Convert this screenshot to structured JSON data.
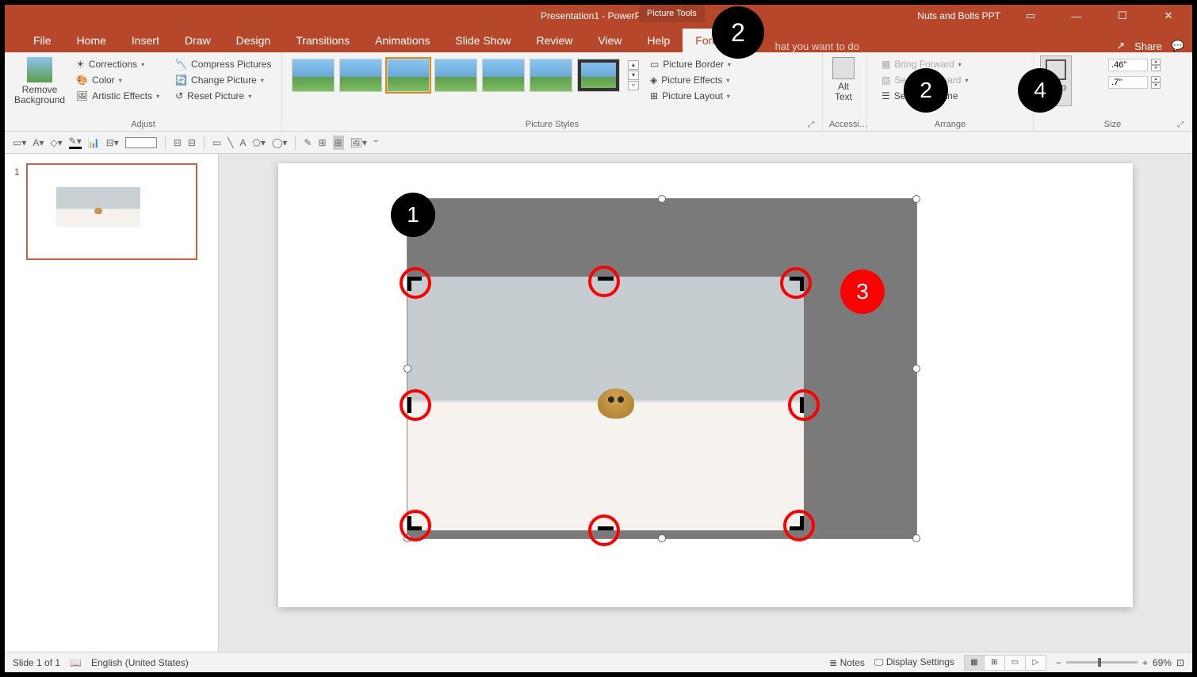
{
  "titlebar": {
    "title": "Presentation1 - PowerPoint",
    "tools_tab": "Picture Tools",
    "brand": "Nuts and Bolts PPT"
  },
  "tabs": {
    "items": [
      "File",
      "Home",
      "Insert",
      "Draw",
      "Design",
      "Transitions",
      "Animations",
      "Slide Show",
      "Review",
      "View",
      "Help",
      "Format"
    ],
    "active": "Format",
    "tellme": "hat you want to do",
    "share": "Share"
  },
  "ribbon": {
    "adjust": {
      "label": "Adjust",
      "remove": "Remove\nBackground",
      "corrections": "Corrections",
      "color": "Color",
      "artistic": "Artistic Effects",
      "compress": "Compress Pictures",
      "change": "Change Picture",
      "reset": "Reset Picture"
    },
    "styles": {
      "label": "Picture Styles",
      "border": "Picture Border",
      "effects": "Picture Effects",
      "layout": "Picture Layout"
    },
    "access": {
      "label": "Accessi…",
      "alt": "Alt\nText"
    },
    "arrange": {
      "label": "Arrange",
      "forward": "Bring Forward",
      "backward": "Send Backward",
      "pane": "Selection Pane"
    },
    "size": {
      "label": "Size",
      "crop": "Crop",
      "h": ".46\"",
      "w": ".7\""
    }
  },
  "thumbs": {
    "num": "1"
  },
  "status": {
    "slide": "Slide 1 of 1",
    "lang": "English (United States)",
    "notes": "Notes",
    "display": "Display Settings",
    "zoom": "69%"
  },
  "annotations": {
    "a1": "1",
    "a2top": "2",
    "a2": "2",
    "a3": "3",
    "a4": "4"
  }
}
